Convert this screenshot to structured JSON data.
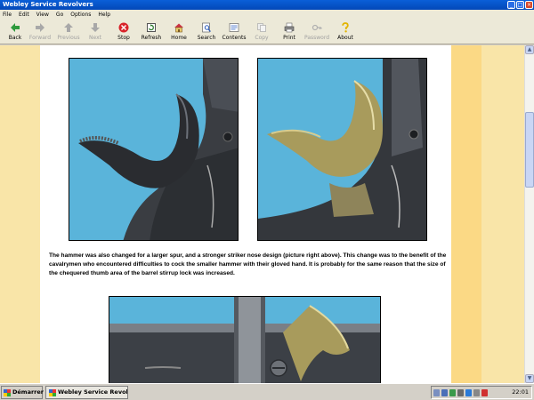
{
  "window": {
    "title": "Webley Service Revolvers"
  },
  "menu": [
    "File",
    "Edit",
    "View",
    "Go",
    "Options",
    "Help"
  ],
  "toolbar": [
    {
      "label": "Back",
      "icon": "back-arrow-icon",
      "enabled": true
    },
    {
      "label": "Forward",
      "icon": "forward-arrow-icon",
      "enabled": false
    },
    {
      "label": "Previous",
      "icon": "up-arrow-icon",
      "enabled": false
    },
    {
      "label": "Next",
      "icon": "down-arrow-icon",
      "enabled": false
    },
    {
      "label": "Stop",
      "icon": "stop-icon",
      "enabled": true
    },
    {
      "label": "Refresh",
      "icon": "refresh-icon",
      "enabled": true
    },
    {
      "label": "Home",
      "icon": "home-icon",
      "enabled": true
    },
    {
      "label": "Search",
      "icon": "search-icon",
      "enabled": true
    },
    {
      "label": "Contents",
      "icon": "contents-icon",
      "enabled": true
    },
    {
      "label": "Copy",
      "icon": "copy-icon",
      "enabled": false
    },
    {
      "label": "Print",
      "icon": "print-icon",
      "enabled": true
    },
    {
      "label": "Password",
      "icon": "password-icon",
      "enabled": false
    },
    {
      "label": "About",
      "icon": "about-icon",
      "enabled": true
    }
  ],
  "content": {
    "caption": "The hammer was also changed for a larger spur, and a stronger striker nose design (picture right above). This change was to the benefit of the cavalrymen who encountered difficulties to cock the smaller hammer with their gloved hand. It is probably for the same reason that the size of the chequered thumb area of the barrel stirrup lock was increased."
  },
  "taskbar": {
    "start_label": "Démarrer",
    "task_label": "Webley Service Revol...",
    "clock": "22:01"
  },
  "colors": {
    "title_bar": "#0a5fd8",
    "page_margin": "#f9e5a8",
    "photo_background": "#5fb6dc"
  }
}
